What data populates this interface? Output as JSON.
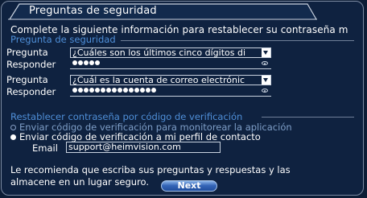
{
  "dialog": {
    "title": "Preguntas de seguridad",
    "intro": "Complete la siguiente información para restablecer su contraseña m"
  },
  "security_section": {
    "legend": "Pregunta de seguridad",
    "question_label": "Pregunta",
    "answer_label": "Responder",
    "questions": [
      {
        "value": "¿Cuáles son los últimos cinco dígitos di",
        "answer_masked_length": 5
      },
      {
        "value": "¿Cuál es la cuenta de correo electrónic",
        "answer_masked_length": 15
      }
    ]
  },
  "verify_section": {
    "legend": "Restablecer contraseña por código de verificación",
    "option_app": "Enviar código de verificación para monitorear la aplicación",
    "option_email": "Enviar código de verificación a mi perfil de contacto",
    "selected_option": "option_email",
    "email_label": "Email",
    "email_value": "support@heimvision.com"
  },
  "footer": {
    "note_line1": "Le recomienda que escriba sus preguntas y respuestas y las",
    "note_line2": "almacene en un lugar seguro.",
    "next_label": "Next"
  },
  "colors": {
    "background": "#0f2240",
    "legend_text": "#4f8fd8",
    "button": "#3566b8"
  }
}
